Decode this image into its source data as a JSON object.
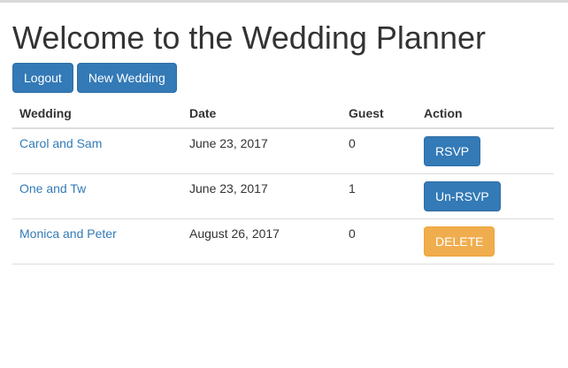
{
  "page": {
    "title": "Welcome to the Wedding Planner"
  },
  "toolbar": {
    "logout_label": "Logout",
    "new_wedding_label": "New Wedding"
  },
  "table": {
    "headers": {
      "wedding": "Wedding",
      "date": "Date",
      "guest": "Guest",
      "action": "Action"
    },
    "rows": [
      {
        "wedding": "Carol and Sam",
        "date": "June 23, 2017",
        "guest": "0",
        "action": "RSVP",
        "action_style": "primary"
      },
      {
        "wedding": "One and Tw",
        "date": "June 23, 2017",
        "guest": "1",
        "action": "Un-RSVP",
        "action_style": "primary"
      },
      {
        "wedding": "Monica and Peter",
        "date": "August 26, 2017",
        "guest": "0",
        "action": "DELETE",
        "action_style": "warning"
      }
    ]
  },
  "colors": {
    "primary": "#337ab7",
    "warning": "#f0ad4e",
    "link": "#337ab7",
    "text": "#333333"
  }
}
